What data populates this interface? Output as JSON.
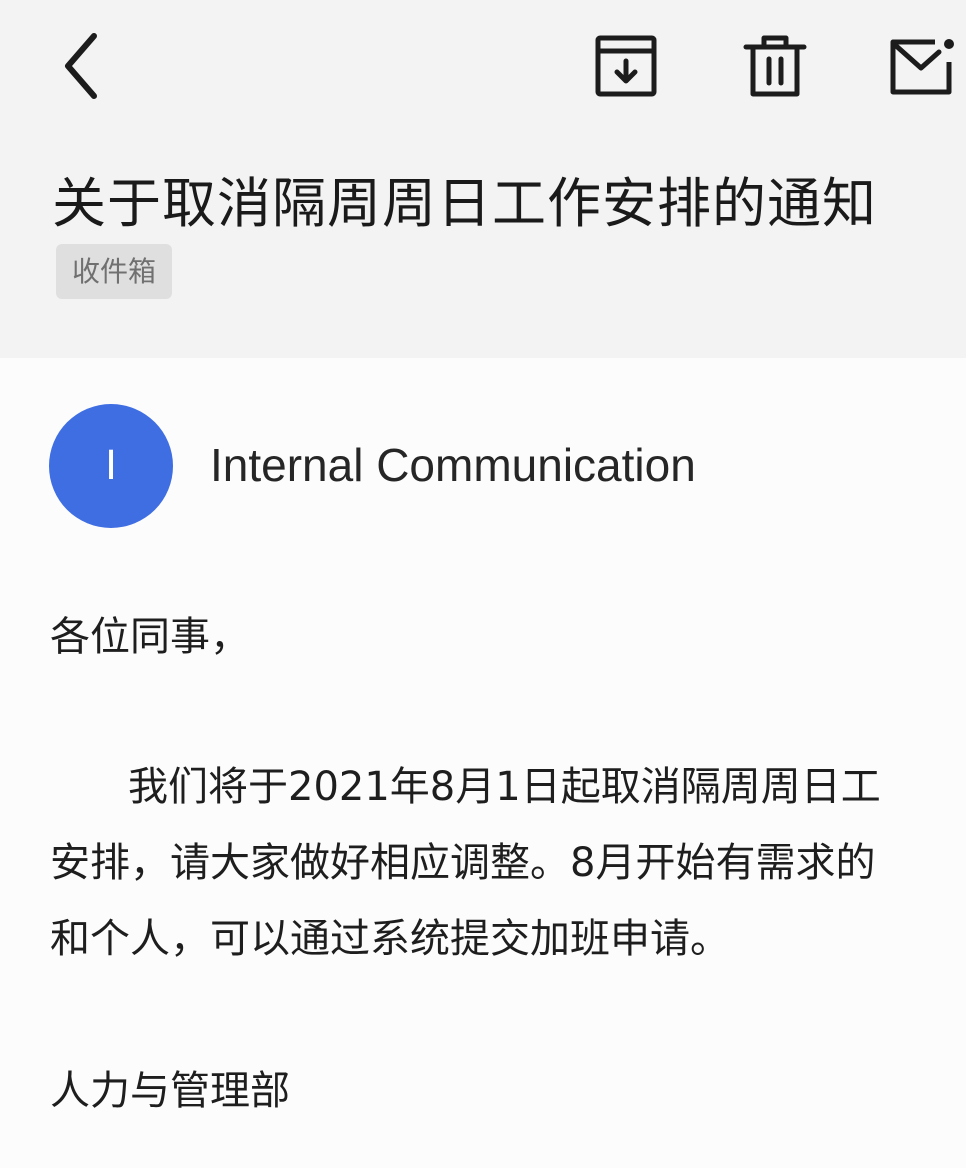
{
  "toolbar": {
    "back_icon": "chevron-left-icon",
    "archive_icon": "archive-download-icon",
    "delete_icon": "trash-icon",
    "mark_unread_icon": "envelope-dot-icon"
  },
  "email": {
    "subject": "关于取消隔周周日工作安排的通知",
    "folder": "收件箱",
    "sender": {
      "initial": "I",
      "name": "Internal Communication",
      "avatar_color": "#3f6ee3"
    },
    "greeting": "各位同事，",
    "paragraph_lines": [
      "我们将于2021年8月1日起取消隔周周日工",
      "安排，请大家做好相应调整。8月开始有需求的",
      "和个人，可以通过系统提交加班申请。"
    ],
    "signature": "人力与管理部"
  }
}
